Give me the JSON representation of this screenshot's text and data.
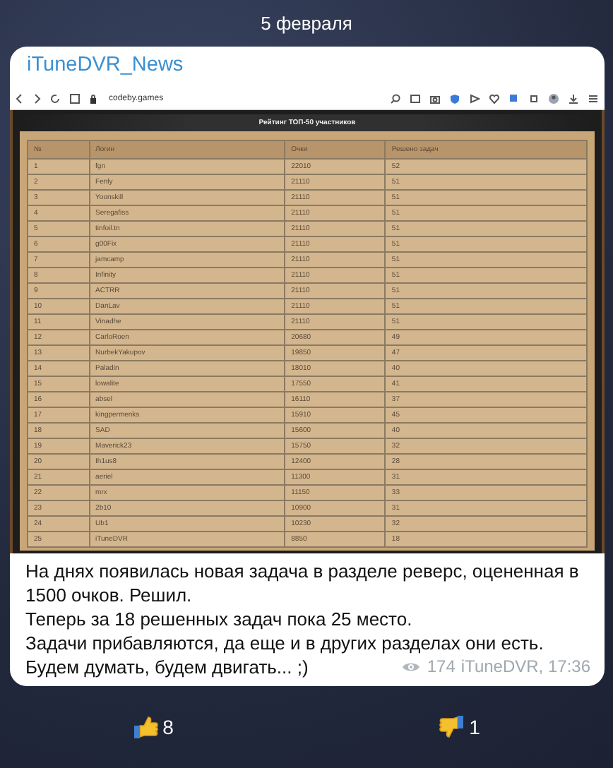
{
  "date": "5 февраля",
  "post": {
    "channel": "iTuneDVR_News",
    "screenshot": {
      "url": "codeby.games",
      "panel_title": "Рейтинг ТОП-50 участников",
      "columns": [
        "№",
        "Логин",
        "Очки",
        "Решено задач"
      ],
      "rows": [
        [
          "1",
          "fgn",
          "22010",
          "52"
        ],
        [
          "2",
          "Fenly",
          "21110",
          "51"
        ],
        [
          "3",
          "Yoonskill",
          "21110",
          "51"
        ],
        [
          "4",
          "Seregafiss",
          "21110",
          "51"
        ],
        [
          "5",
          "tinfoil.tn",
          "21110",
          "51"
        ],
        [
          "6",
          "g00Fix",
          "21110",
          "51"
        ],
        [
          "7",
          "jamcamp",
          "21110",
          "51"
        ],
        [
          "8",
          "Infinity",
          "21110",
          "51"
        ],
        [
          "9",
          "ACTRR",
          "21110",
          "51"
        ],
        [
          "10",
          "DanLav",
          "21110",
          "51"
        ],
        [
          "11",
          "Vinadhe",
          "21110",
          "51"
        ],
        [
          "12",
          "CarloRoen",
          "20680",
          "49"
        ],
        [
          "13",
          "NurbekYakupov",
          "19850",
          "47"
        ],
        [
          "14",
          "Paladin",
          "18010",
          "40"
        ],
        [
          "15",
          "lowalite",
          "17550",
          "41"
        ],
        [
          "16",
          "absel",
          "16110",
          "37"
        ],
        [
          "17",
          "kingpermenks",
          "15910",
          "45"
        ],
        [
          "18",
          "SAD",
          "15600",
          "40"
        ],
        [
          "19",
          "Maverick23",
          "15750",
          "32"
        ],
        [
          "20",
          "Ih1us8",
          "12400",
          "28"
        ],
        [
          "21",
          "aeriel",
          "11300",
          "31"
        ],
        [
          "22",
          "mrx",
          "11150",
          "33"
        ],
        [
          "23",
          "2b10",
          "10900",
          "31"
        ],
        [
          "24",
          "Ub1",
          "10230",
          "32"
        ],
        [
          "25",
          "iTuneDVR",
          "8850",
          "18"
        ]
      ]
    },
    "paragraphs": [
      "На днях появилась новая задача в разделе реверс, оцененная в 1500 очков. Решил.",
      "Теперь за 18 решенных задач пока 25 место.",
      "Задачи прибавляются, да еще и в других разделах они есть.",
      "Будем думать, будем двигать... ;)"
    ],
    "views": "174",
    "signature": "iTuneDVR, 17:36"
  },
  "reactions": [
    {
      "kind": "like",
      "count": "8"
    },
    {
      "kind": "dislike",
      "count": "1"
    }
  ]
}
